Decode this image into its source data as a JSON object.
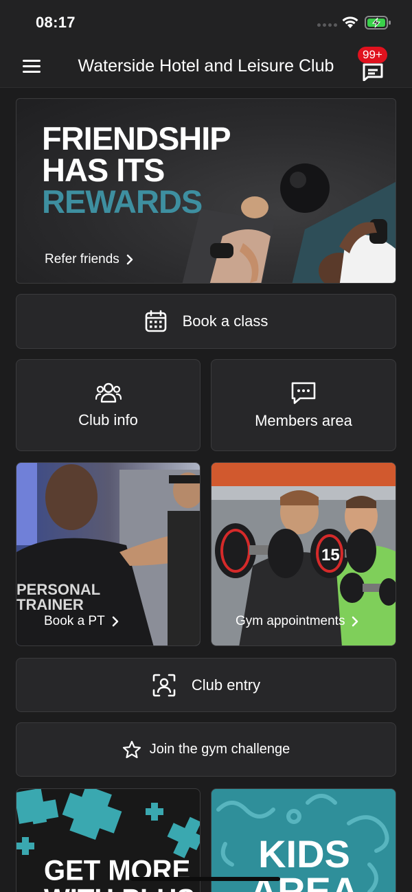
{
  "status": {
    "time": "08:17"
  },
  "header": {
    "title": "Waterside Hotel and Leisure Club",
    "badge": "99+"
  },
  "hero": {
    "line1": "FRIENDSHIP",
    "line2": "HAS ITS",
    "line3": "REWARDS",
    "link_label": "Refer friends"
  },
  "actions": {
    "book_class": "Book a class",
    "club_info": "Club info",
    "members_area": "Members area",
    "book_pt": "Book a PT",
    "pt_shirt_line1": "PERSONAL",
    "pt_shirt_line2": "TRAINER",
    "gym_appointments": "Gym appointments",
    "dumbbell_weight": "15",
    "club_entry": "Club entry",
    "gym_challenge": "Join the gym challenge"
  },
  "promos": {
    "plus_line1": "GET MORE",
    "plus_line2": "WITH PLUS",
    "kids_line1": "KIDS",
    "kids_line2": "AREA"
  },
  "colors": {
    "background": "#1c1c1d",
    "card": "#272729",
    "accent_teal": "#3e8fa0",
    "badge_red": "#e0121e"
  }
}
